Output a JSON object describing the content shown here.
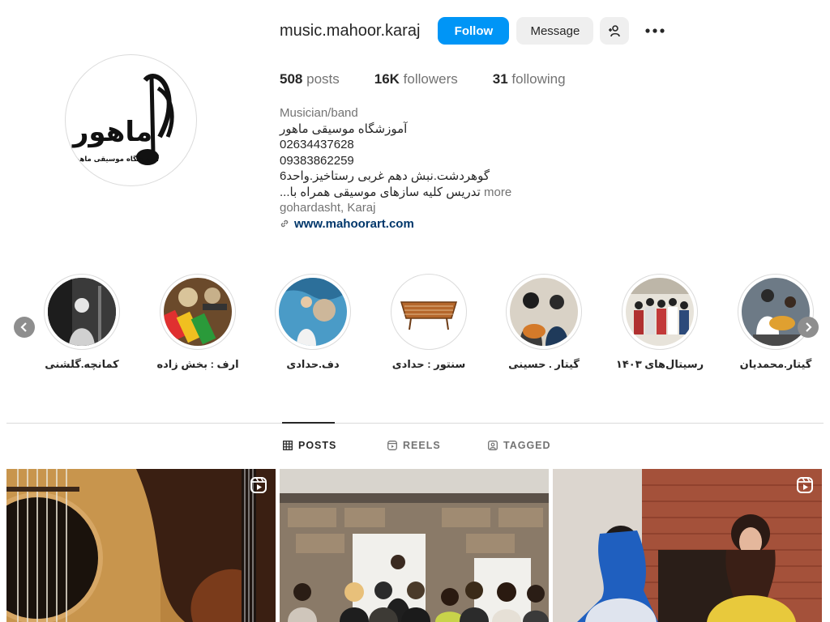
{
  "profile": {
    "username": "music.mahoor.karaj",
    "follow_label": "Follow",
    "message_label": "Message",
    "logo_text": "ماهور",
    "logo_subtext": "آموزشگاه موسیقی ماهور"
  },
  "stats": {
    "posts_count": "508",
    "posts_label": "posts",
    "followers_count": "16K",
    "followers_label": "followers",
    "following_count": "31",
    "following_label": "following"
  },
  "bio": {
    "category": "Musician/band",
    "name": "آموزشگاه موسیقی ماهور",
    "phone1": "02634437628",
    "phone2": "09383862259",
    "address": "گوهردشت.نبش دهم غربی رستاخیز.واحد6",
    "teaching": "تدریس کلیه سازهای موسیقی همراه با...",
    "more_label": "more",
    "location": "gohardasht, Karaj",
    "website": "www.mahoorart.com"
  },
  "highlights": [
    {
      "label": "کمانچه.گلشنی"
    },
    {
      "label": "ارف : بخش زاده"
    },
    {
      "label": "دف.حدادی"
    },
    {
      "label": "سنتور : حدادی"
    },
    {
      "label": "گیتار . حسینی"
    },
    {
      "label": "رسیتال‌های ۱۴۰۳"
    },
    {
      "label": "گیتار.محمدیان"
    }
  ],
  "tabs": {
    "posts": "POSTS",
    "reels": "REELS",
    "tagged": "TAGGED"
  },
  "icons": {
    "add_user": "add-user-icon",
    "more": "more-dots-icon",
    "link": "link-icon",
    "prev": "chevron-left-icon",
    "next": "chevron-right-icon",
    "grid": "grid-icon",
    "reels": "reels-icon",
    "tagged": "tagged-icon",
    "reel_badge": "reel-badge-icon"
  },
  "colors": {
    "primary": "#0095f6",
    "link": "#00376b",
    "muted": "#737373"
  }
}
